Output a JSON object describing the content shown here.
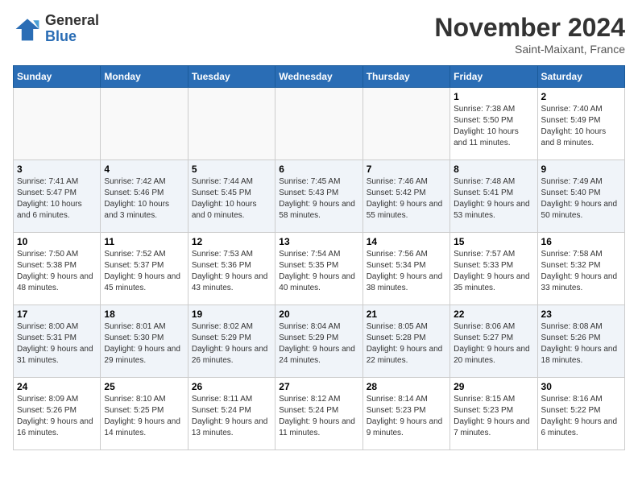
{
  "header": {
    "logo": {
      "general": "General",
      "blue": "Blue"
    },
    "title": "November 2024",
    "location": "Saint-Maixant, France"
  },
  "weekdays": [
    "Sunday",
    "Monday",
    "Tuesday",
    "Wednesday",
    "Thursday",
    "Friday",
    "Saturday"
  ],
  "weeks": [
    [
      {
        "day": "",
        "info": ""
      },
      {
        "day": "",
        "info": ""
      },
      {
        "day": "",
        "info": ""
      },
      {
        "day": "",
        "info": ""
      },
      {
        "day": "",
        "info": ""
      },
      {
        "day": "1",
        "info": "Sunrise: 7:38 AM\nSunset: 5:50 PM\nDaylight: 10 hours and 11 minutes."
      },
      {
        "day": "2",
        "info": "Sunrise: 7:40 AM\nSunset: 5:49 PM\nDaylight: 10 hours and 8 minutes."
      }
    ],
    [
      {
        "day": "3",
        "info": "Sunrise: 7:41 AM\nSunset: 5:47 PM\nDaylight: 10 hours and 6 minutes."
      },
      {
        "day": "4",
        "info": "Sunrise: 7:42 AM\nSunset: 5:46 PM\nDaylight: 10 hours and 3 minutes."
      },
      {
        "day": "5",
        "info": "Sunrise: 7:44 AM\nSunset: 5:45 PM\nDaylight: 10 hours and 0 minutes."
      },
      {
        "day": "6",
        "info": "Sunrise: 7:45 AM\nSunset: 5:43 PM\nDaylight: 9 hours and 58 minutes."
      },
      {
        "day": "7",
        "info": "Sunrise: 7:46 AM\nSunset: 5:42 PM\nDaylight: 9 hours and 55 minutes."
      },
      {
        "day": "8",
        "info": "Sunrise: 7:48 AM\nSunset: 5:41 PM\nDaylight: 9 hours and 53 minutes."
      },
      {
        "day": "9",
        "info": "Sunrise: 7:49 AM\nSunset: 5:40 PM\nDaylight: 9 hours and 50 minutes."
      }
    ],
    [
      {
        "day": "10",
        "info": "Sunrise: 7:50 AM\nSunset: 5:38 PM\nDaylight: 9 hours and 48 minutes."
      },
      {
        "day": "11",
        "info": "Sunrise: 7:52 AM\nSunset: 5:37 PM\nDaylight: 9 hours and 45 minutes."
      },
      {
        "day": "12",
        "info": "Sunrise: 7:53 AM\nSunset: 5:36 PM\nDaylight: 9 hours and 43 minutes."
      },
      {
        "day": "13",
        "info": "Sunrise: 7:54 AM\nSunset: 5:35 PM\nDaylight: 9 hours and 40 minutes."
      },
      {
        "day": "14",
        "info": "Sunrise: 7:56 AM\nSunset: 5:34 PM\nDaylight: 9 hours and 38 minutes."
      },
      {
        "day": "15",
        "info": "Sunrise: 7:57 AM\nSunset: 5:33 PM\nDaylight: 9 hours and 35 minutes."
      },
      {
        "day": "16",
        "info": "Sunrise: 7:58 AM\nSunset: 5:32 PM\nDaylight: 9 hours and 33 minutes."
      }
    ],
    [
      {
        "day": "17",
        "info": "Sunrise: 8:00 AM\nSunset: 5:31 PM\nDaylight: 9 hours and 31 minutes."
      },
      {
        "day": "18",
        "info": "Sunrise: 8:01 AM\nSunset: 5:30 PM\nDaylight: 9 hours and 29 minutes."
      },
      {
        "day": "19",
        "info": "Sunrise: 8:02 AM\nSunset: 5:29 PM\nDaylight: 9 hours and 26 minutes."
      },
      {
        "day": "20",
        "info": "Sunrise: 8:04 AM\nSunset: 5:29 PM\nDaylight: 9 hours and 24 minutes."
      },
      {
        "day": "21",
        "info": "Sunrise: 8:05 AM\nSunset: 5:28 PM\nDaylight: 9 hours and 22 minutes."
      },
      {
        "day": "22",
        "info": "Sunrise: 8:06 AM\nSunset: 5:27 PM\nDaylight: 9 hours and 20 minutes."
      },
      {
        "day": "23",
        "info": "Sunrise: 8:08 AM\nSunset: 5:26 PM\nDaylight: 9 hours and 18 minutes."
      }
    ],
    [
      {
        "day": "24",
        "info": "Sunrise: 8:09 AM\nSunset: 5:26 PM\nDaylight: 9 hours and 16 minutes."
      },
      {
        "day": "25",
        "info": "Sunrise: 8:10 AM\nSunset: 5:25 PM\nDaylight: 9 hours and 14 minutes."
      },
      {
        "day": "26",
        "info": "Sunrise: 8:11 AM\nSunset: 5:24 PM\nDaylight: 9 hours and 13 minutes."
      },
      {
        "day": "27",
        "info": "Sunrise: 8:12 AM\nSunset: 5:24 PM\nDaylight: 9 hours and 11 minutes."
      },
      {
        "day": "28",
        "info": "Sunrise: 8:14 AM\nSunset: 5:23 PM\nDaylight: 9 hours and 9 minutes."
      },
      {
        "day": "29",
        "info": "Sunrise: 8:15 AM\nSunset: 5:23 PM\nDaylight: 9 hours and 7 minutes."
      },
      {
        "day": "30",
        "info": "Sunrise: 8:16 AM\nSunset: 5:22 PM\nDaylight: 9 hours and 6 minutes."
      }
    ]
  ]
}
